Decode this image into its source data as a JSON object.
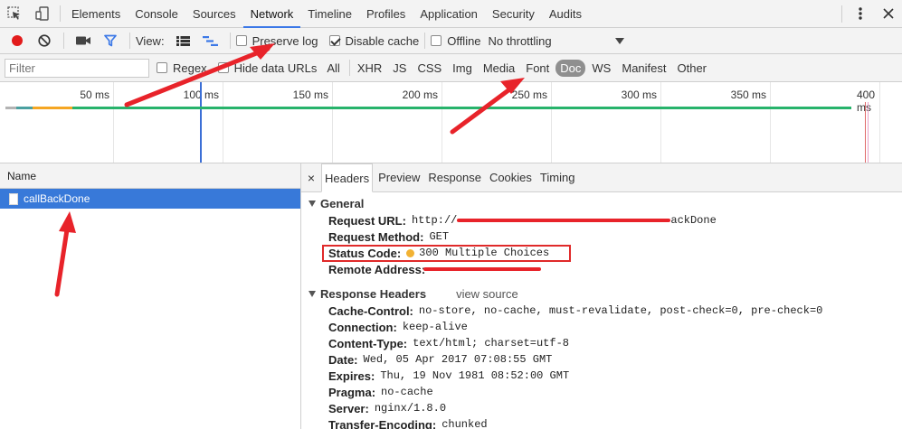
{
  "tabs": [
    "Elements",
    "Console",
    "Sources",
    "Network",
    "Timeline",
    "Profiles",
    "Application",
    "Security",
    "Audits"
  ],
  "active_tab": "Network",
  "toolbar": {
    "view_label": "View:",
    "preserve_log": "Preserve log",
    "disable_cache": "Disable cache",
    "offline": "Offline",
    "throttling": "No throttling"
  },
  "filterbar": {
    "filter_placeholder": "Filter",
    "regex_label": "Regex",
    "hide_data_urls": "Hide data URLs",
    "types": [
      "All",
      "XHR",
      "JS",
      "CSS",
      "Img",
      "Media",
      "Font",
      "Doc",
      "WS",
      "Manifest",
      "Other"
    ],
    "active_type": "Doc"
  },
  "overview": {
    "ticks": [
      "50 ms",
      "100 ms",
      "150 ms",
      "200 ms",
      "250 ms",
      "300 ms",
      "350 ms",
      "400 ms"
    ]
  },
  "requests": {
    "column_name": "Name",
    "items": [
      "callBackDone"
    ]
  },
  "details": {
    "tabs": [
      "Headers",
      "Preview",
      "Response",
      "Cookies",
      "Timing"
    ],
    "active_tab": "Headers",
    "close_icon": "×",
    "general_title": "General",
    "request_url_key": "Request URL:",
    "request_url_prefix": "http://",
    "request_url_suffix": "ackDone",
    "request_method_key": "Request Method:",
    "request_method_val": "GET",
    "status_code_key": "Status Code:",
    "status_code_val": "300 Multiple Choices",
    "remote_address_key": "Remote Address:",
    "response_headers_title": "Response Headers",
    "view_source": "view source",
    "response_headers": [
      {
        "k": "Cache-Control:",
        "v": "no-store, no-cache, must-revalidate, post-check=0, pre-check=0"
      },
      {
        "k": "Connection:",
        "v": "keep-alive"
      },
      {
        "k": "Content-Type:",
        "v": "text/html; charset=utf-8"
      },
      {
        "k": "Date:",
        "v": "Wed, 05 Apr 2017 07:08:55 GMT"
      },
      {
        "k": "Expires:",
        "v": "Thu, 19 Nov 1981 08:52:00 GMT"
      },
      {
        "k": "Pragma:",
        "v": "no-cache"
      },
      {
        "k": "Server:",
        "v": "nginx/1.8.0"
      },
      {
        "k": "Transfer-Encoding:",
        "v": "chunked"
      }
    ]
  },
  "colors": {
    "accent": "#3b78e7",
    "selected_row": "#3879d9",
    "record_red": "#e21b1b",
    "annotation_red": "#e8232a",
    "status_dot": "#f2b233"
  }
}
